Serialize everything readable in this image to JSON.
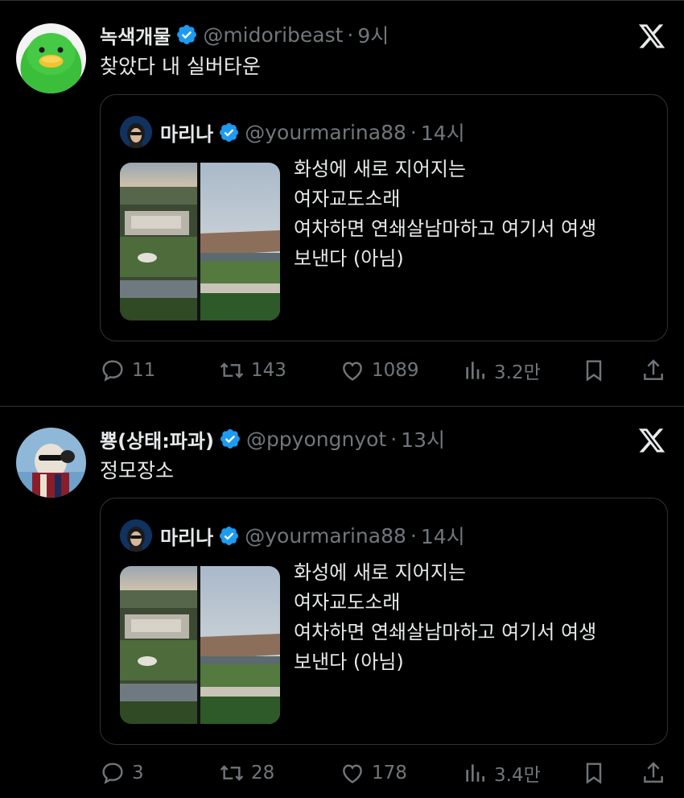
{
  "tweets": [
    {
      "author": {
        "name": "녹색개물",
        "handle": "@midoribeast",
        "time": "9시"
      },
      "text": "찾았다 내 실버타운",
      "quote": {
        "author": {
          "name": "마리나",
          "handle": "@yourmarina88",
          "time": "14시"
        },
        "lines": [
          "화성에 새로 지어지는",
          "여자교도소래",
          "여차하면 연쇄살남마하고 여기서 여생",
          "보낸다 (아님)"
        ]
      },
      "stats": {
        "replies": "11",
        "retweets": "143",
        "likes": "1089",
        "views": "3.2만"
      }
    },
    {
      "author": {
        "name": "뿅(상태:파과)",
        "handle": "@ppyongnyot",
        "time": "13시"
      },
      "text": "정모장소",
      "quote": {
        "author": {
          "name": "마리나",
          "handle": "@yourmarina88",
          "time": "14시"
        },
        "lines": [
          "화성에 새로 지어지는",
          "여자교도소래",
          "여차하면 연쇄살남마하고 여기서 여생",
          "보낸다 (아님)"
        ]
      },
      "stats": {
        "replies": "3",
        "retweets": "28",
        "likes": "178",
        "views": "3.4만"
      }
    }
  ],
  "separator": "·",
  "colors": {
    "background": "#000000",
    "text": "#e7e9ea",
    "muted": "#71767b",
    "verified": "#1d9bf0",
    "border": "#2f3336"
  },
  "icons": [
    "verified-badge-icon",
    "x-logo-icon",
    "reply-icon",
    "retweet-icon",
    "like-icon",
    "views-icon",
    "bookmark-icon",
    "share-icon"
  ]
}
